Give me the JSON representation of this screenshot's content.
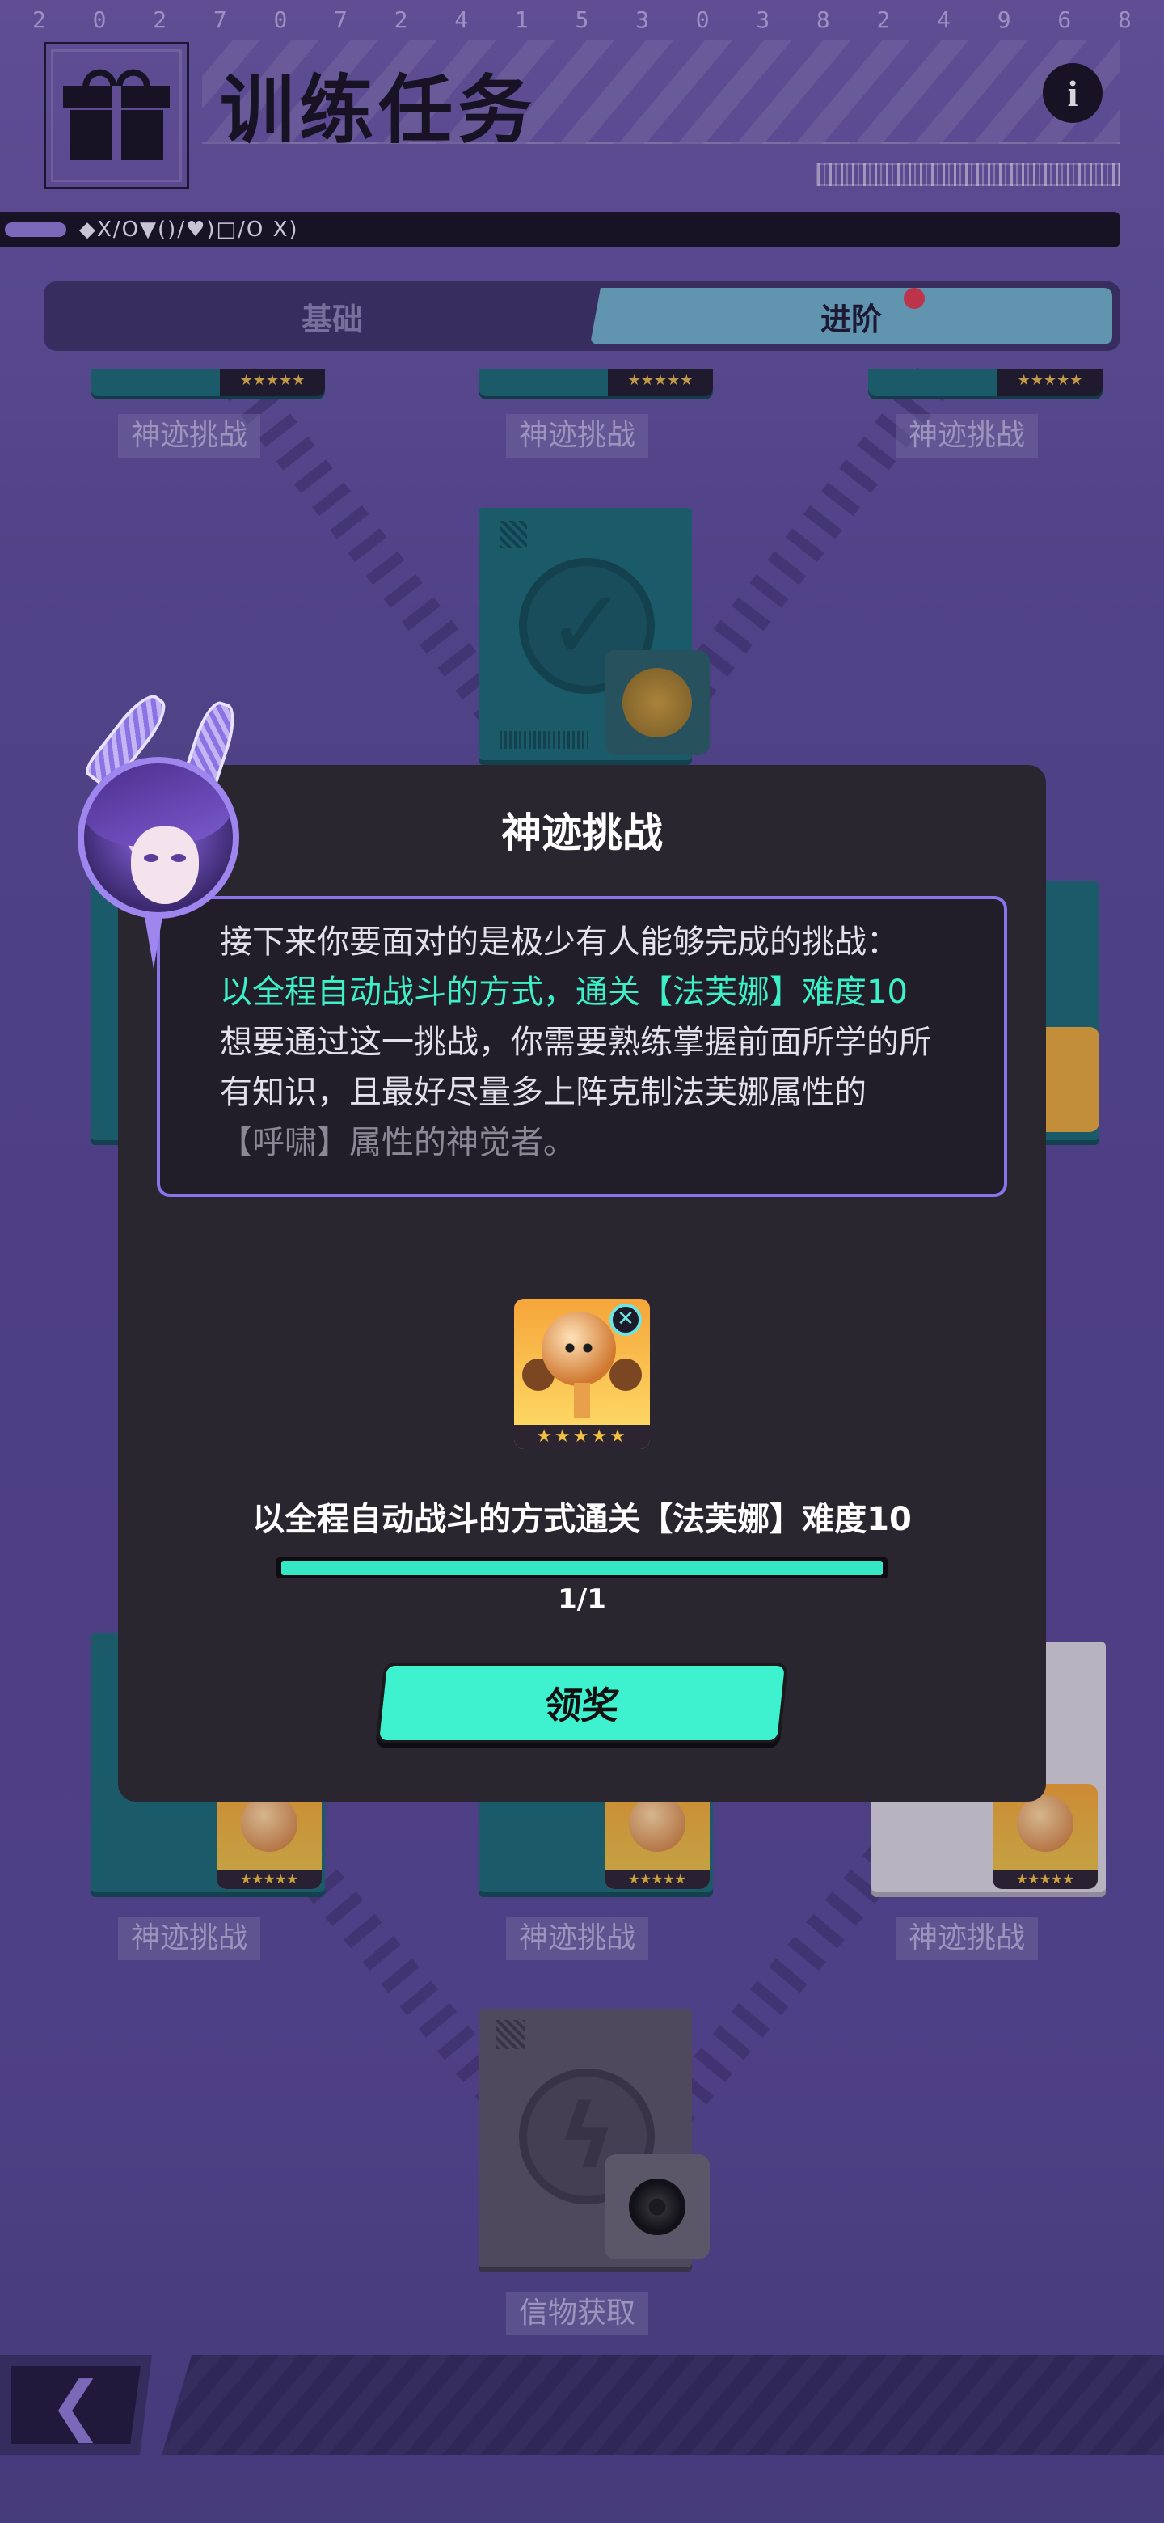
{
  "header": {
    "digits": [
      "2",
      "0",
      "2",
      "7",
      "0",
      "7",
      "2",
      "4",
      "1",
      "5",
      "3",
      "0",
      "3",
      "8",
      "2",
      "4",
      "9",
      "6",
      "8"
    ],
    "title": "训练任务",
    "info_label": "i",
    "symbols": "◆X/O▼()/♥)□/O X)"
  },
  "tabs": {
    "basic": "基础",
    "advanced": "进阶",
    "active": "进阶",
    "advanced_has_notice": true
  },
  "map": {
    "top_labels": [
      "神迹挑战",
      "神迹挑战",
      "神迹挑战"
    ],
    "bottom_labels": [
      "神迹挑战",
      "神迹挑战",
      "神迹挑战"
    ],
    "final_label": "信物获取",
    "stars": "★★★★★"
  },
  "dialog": {
    "title": "神迹挑战",
    "desc_line1": "接下来你要面对的是极少有人能够完成的挑战：",
    "desc_highlight": "以全程自动战斗的方式，通关【法芙娜】难度10",
    "desc_line2": "想要通过这一挑战，你需要熟练掌握前面所学的所有知识，且最好尽量多上阵克制法芙娜属性的",
    "desc_line3": "【呼啸】属性的神觉者。",
    "reward_stars": "★★★★★",
    "task": "以全程自动战斗的方式通关【法芙娜】难度10",
    "progress_text": "1/1",
    "progress": 1.0,
    "claim_button": "领奖"
  },
  "colors": {
    "accent": "#3ff2cf",
    "dialog_border": "#8a74ea",
    "notice_dot": "#e13a4e"
  },
  "icons": [
    "gift-icon",
    "info-icon",
    "check-icon",
    "coin-icon",
    "vinyl-icon",
    "lightning-icon",
    "back-arrow-icon"
  ]
}
